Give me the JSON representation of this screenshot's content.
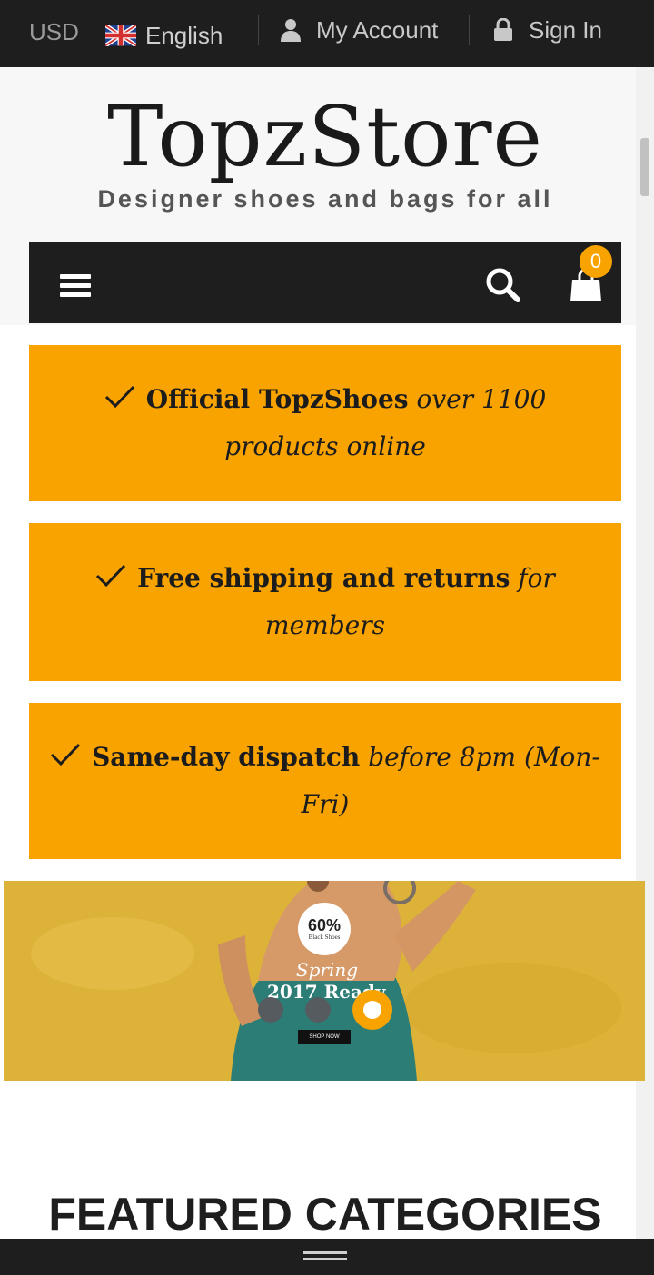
{
  "topbar": {
    "currency": "USD",
    "language": "English",
    "my_account": "My Account",
    "sign_in": "Sign In"
  },
  "header": {
    "logo": "TopzStore",
    "tagline": "Designer shoes and bags for all",
    "cart_count": "0"
  },
  "features": [
    {
      "bold": "Official TopzShoes",
      "italic": "over 1100 products online"
    },
    {
      "bold": "Free shipping and returns",
      "italic": "for members"
    },
    {
      "bold": "Same-day dispatch",
      "italic": "before 8pm (Mon-Fri)"
    }
  ],
  "banner": {
    "badge_value": "60%",
    "badge_label": "Black Shoes",
    "line1": "Spring",
    "line2": "2017 Ready",
    "button": "SHOP NOW",
    "active_slide": 3,
    "slide_count": 3
  },
  "sections": {
    "featured_title": "FEATURED CATEGORIES"
  },
  "colors": {
    "accent": "#f9a300",
    "dark": "#1e1e1e"
  }
}
